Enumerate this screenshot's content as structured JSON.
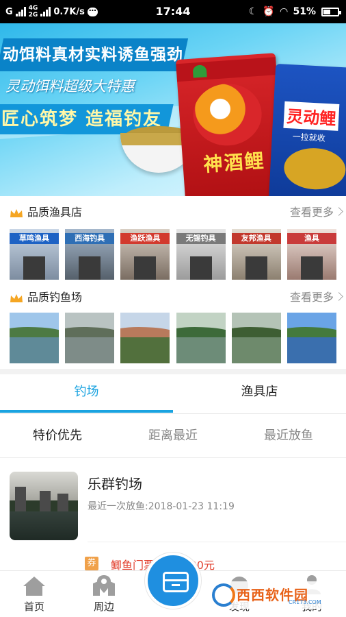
{
  "status_bar": {
    "carrier": "G",
    "network_top": "4G",
    "network_bottom": "2G",
    "speed": "0.7K/s",
    "time": "17:44",
    "battery": "51%",
    "battery_level": 0.51
  },
  "banner": {
    "line1": "动饵料真材实料诱鱼强劲",
    "line2": "灵动饵料超级大特惠",
    "line3": "匠心筑梦  造福钓友",
    "bag_red_text": "神酒鲤",
    "bag_blue_text": "灵动鲤",
    "bag_blue_sub": "一拉就收",
    "active_slide": 3,
    "slide_count": 4
  },
  "shops_section": {
    "title": "品质渔具店",
    "more": "查看更多",
    "thumbs": [
      {
        "sign": "草鸣渔具",
        "color": "#1e62c4"
      },
      {
        "sign": "西海钓具",
        "color": "#2f6fb5"
      },
      {
        "sign": "渔跃渔具",
        "color": "#d23a2e"
      },
      {
        "sign": "无锡钓具",
        "color": "#7a7a7a"
      },
      {
        "sign": "友邦渔具",
        "color": "#c2392d"
      },
      {
        "sign": "渔具",
        "color": "#c93b3b"
      }
    ]
  },
  "ponds_section": {
    "title": "品质钓鱼场",
    "more": "查看更多"
  },
  "tabs": {
    "active": "钓场",
    "inactive": "渔具店"
  },
  "sorts": [
    "特价优先",
    "距离最近",
    "最近放鱼"
  ],
  "list": [
    {
      "name": "乐群钓场",
      "last_release": "最近一次放鱼:2018-01-23 11:19",
      "coupon_tag": "券",
      "coupon_text": "鲫鱼门票：120.00元"
    }
  ],
  "bottom_nav": {
    "home": "首页",
    "nearby": "周边",
    "discover": "发现",
    "mine": "我的"
  },
  "watermark": {
    "text": "西西软件园",
    "sub": "CR173.COM"
  }
}
